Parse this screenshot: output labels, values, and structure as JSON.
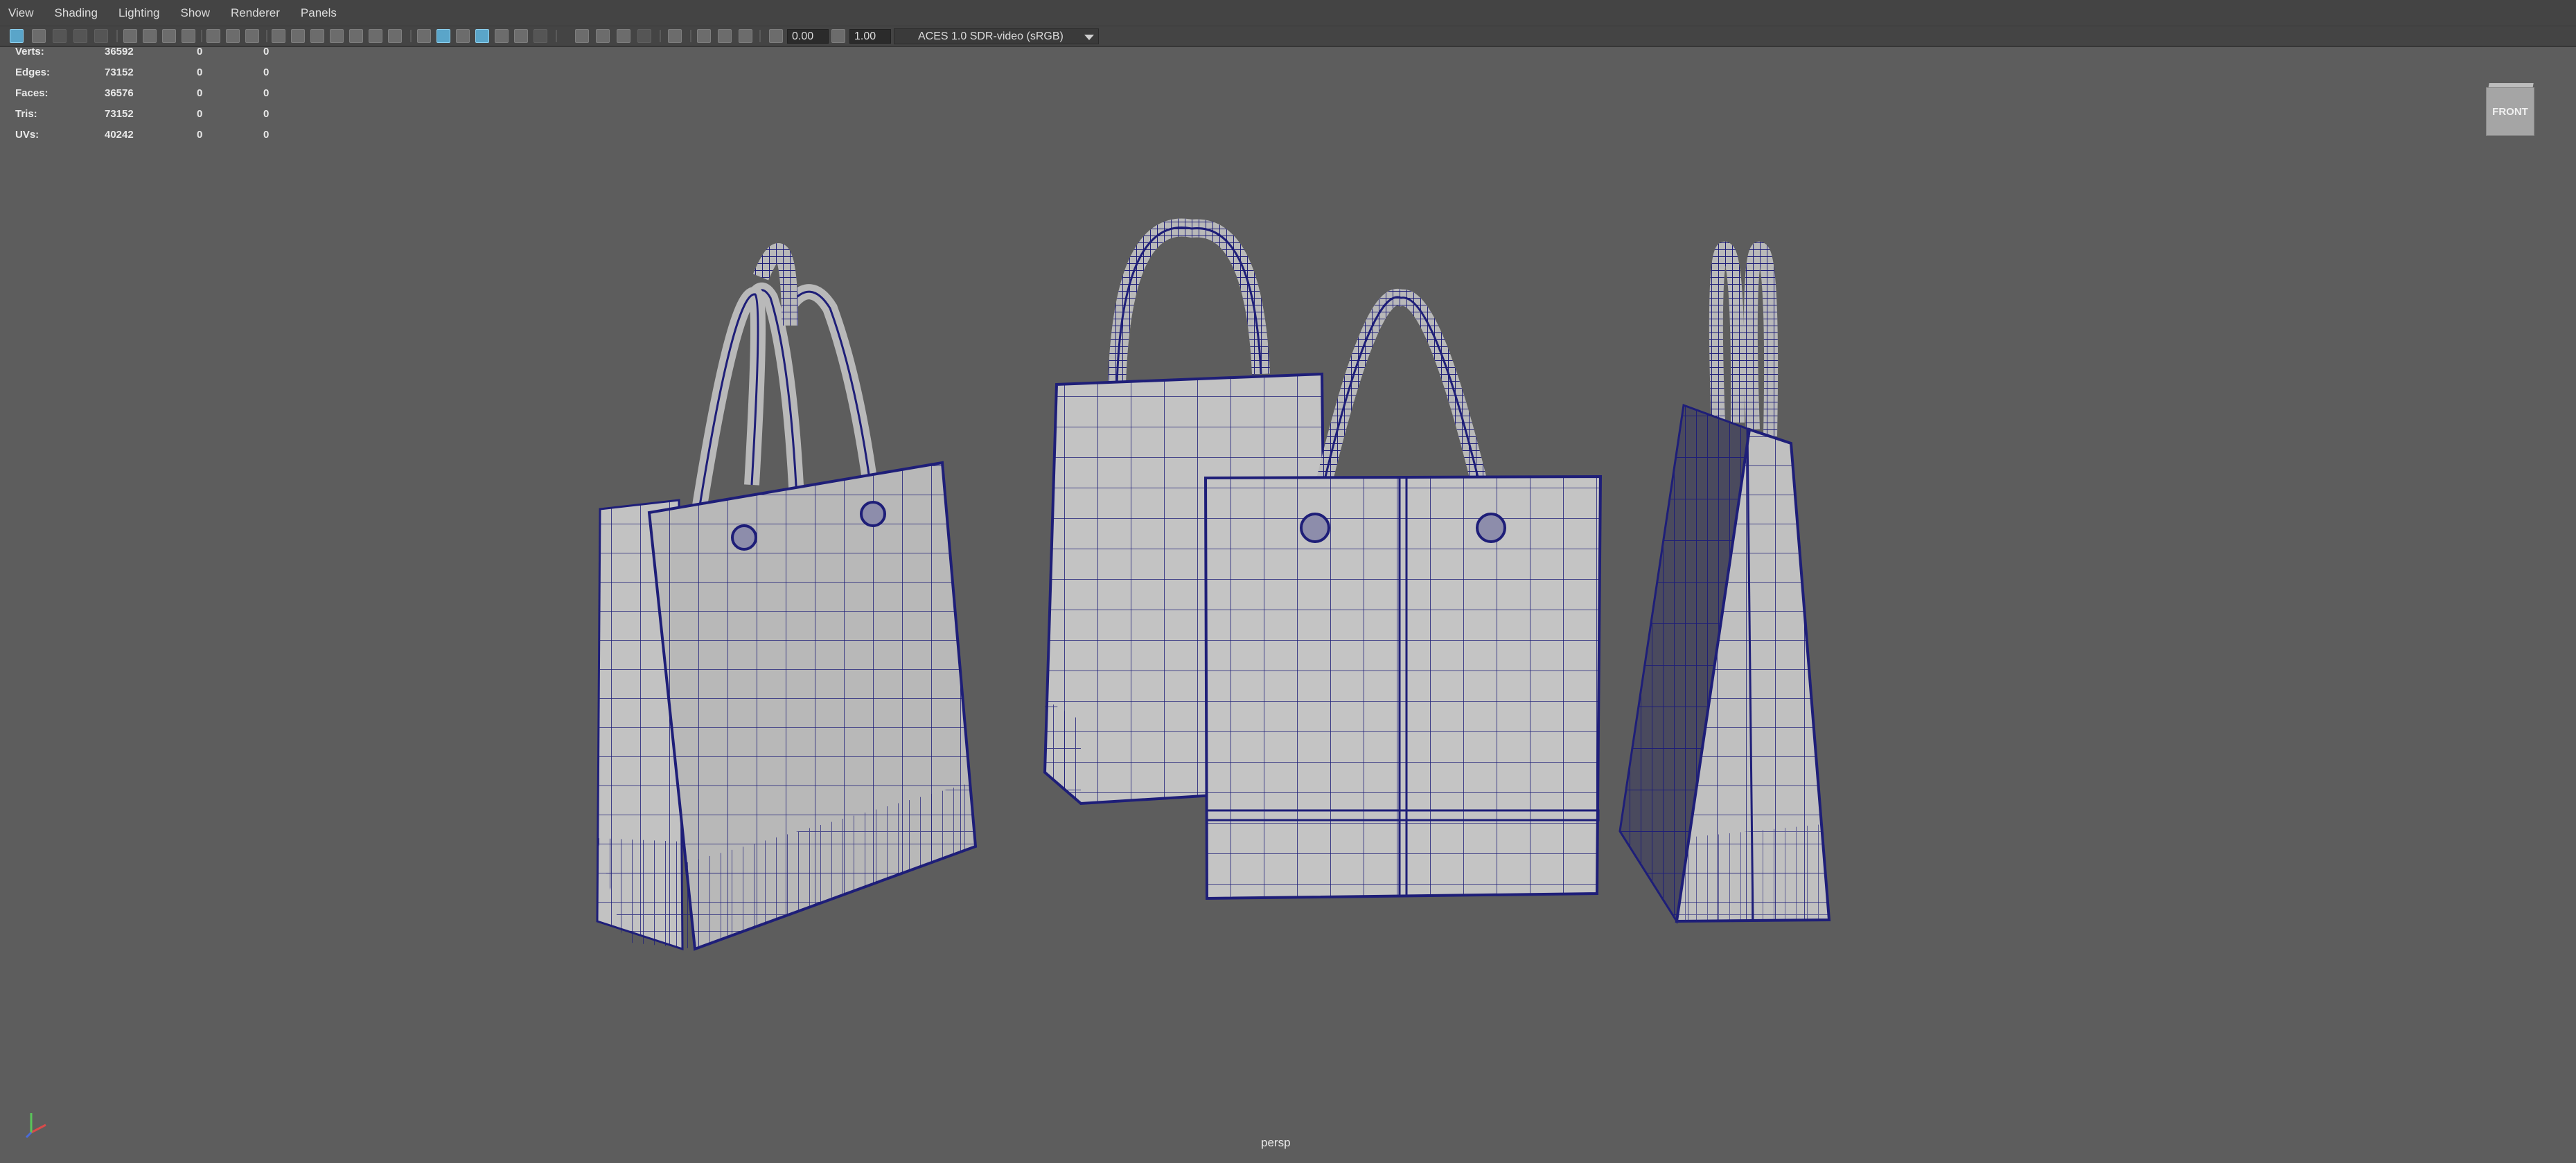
{
  "menubar": {
    "items": [
      "View",
      "Shading",
      "Lighting",
      "Show",
      "Renderer",
      "Panels"
    ]
  },
  "toolbar": {
    "exposure_value": "0.00",
    "gamma_value": "1.00",
    "color_space": "ACES 1.0 SDR-video (sRGB)"
  },
  "hud": {
    "rows": [
      {
        "label": "Verts:",
        "v1": "36592",
        "v2": "0",
        "v3": "0"
      },
      {
        "label": "Edges:",
        "v1": "73152",
        "v2": "0",
        "v3": "0"
      },
      {
        "label": "Faces:",
        "v1": "36576",
        "v2": "0",
        "v3": "0"
      },
      {
        "label": "Tris:",
        "v1": "73152",
        "v2": "0",
        "v3": "0"
      },
      {
        "label": "UVs:",
        "v1": "40242",
        "v2": "0",
        "v3": "0"
      }
    ]
  },
  "viewcube": {
    "face_label": "FRONT"
  },
  "viewport": {
    "camera_name": "persp"
  },
  "colors": {
    "viewport_bg": "#5d5d5d",
    "wire": "#1e1e78",
    "surface": "#bfbfbf",
    "accent": "#5aa5c9"
  },
  "icons": {
    "toolbar": [
      "select-camera-icon",
      "camera-attributes-icon",
      "bookmarks-icon",
      "image-plane-icon",
      "grid-icon",
      "film-gate-icon",
      "resolution-gate-icon",
      "gate-mask-icon",
      "field-chart-icon",
      "safe-action-icon",
      "safe-title-icon",
      "wireframe-icon",
      "smooth-shade-icon",
      "wireframe-on-shaded-icon",
      "textured-icon",
      "use-all-lights-icon",
      "shadows-icon",
      "ambient-occlusion-icon",
      "motion-blur-icon",
      "anti-aliasing-icon",
      "isolate-select-icon",
      "xray-icon",
      "xray-joints-icon",
      "exposure-icon",
      "gamma-icon",
      "color-management-icon"
    ],
    "axis": "axis-gizmo-icon"
  }
}
